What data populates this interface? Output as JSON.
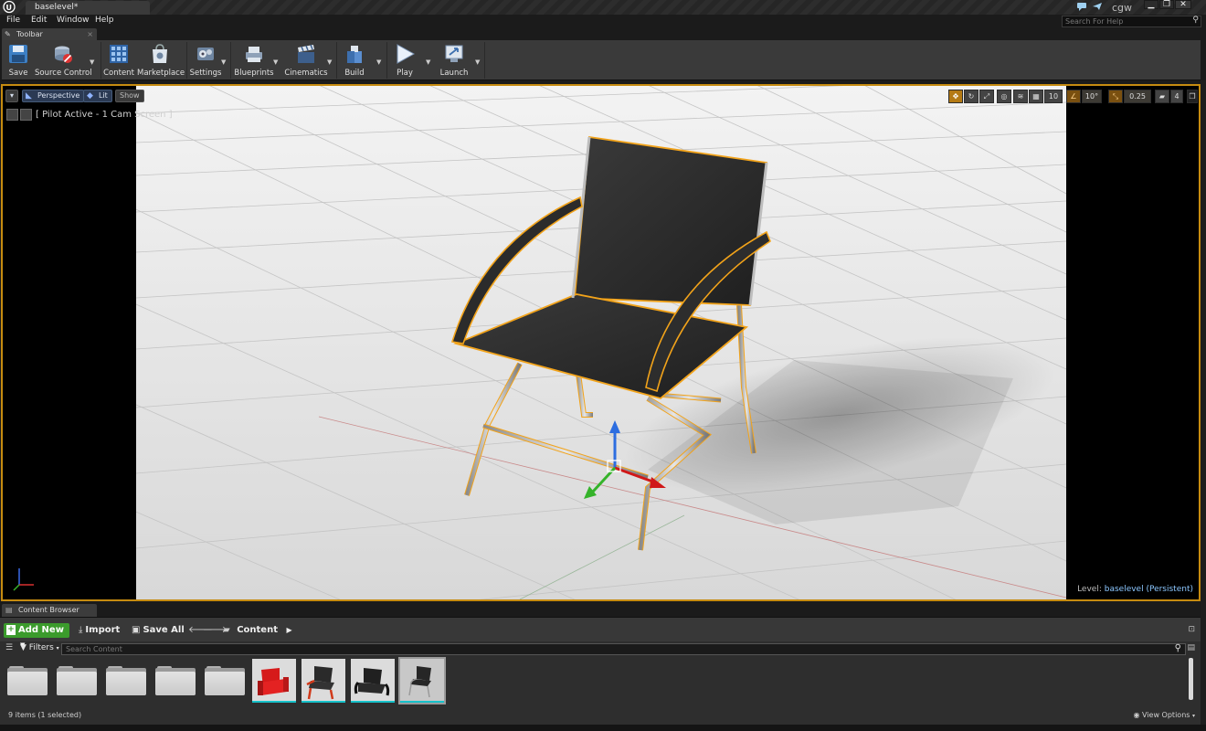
{
  "window": {
    "doc_tab": "baselevel*",
    "user": "cgw",
    "help_search_placeholder": "Search For Help"
  },
  "menu": [
    "File",
    "Edit",
    "Window",
    "Help"
  ],
  "toolbar": {
    "tab_label": "Toolbar",
    "buttons": [
      {
        "label": "Save",
        "icon": "save-icon"
      },
      {
        "label": "Source Control",
        "icon": "source-control-icon"
      },
      {
        "label": "Content",
        "icon": "content-icon"
      },
      {
        "label": "Marketplace",
        "icon": "marketplace-icon"
      },
      {
        "label": "Settings",
        "icon": "settings-icon"
      },
      {
        "label": "Blueprints",
        "icon": "blueprints-icon"
      },
      {
        "label": "Cinematics",
        "icon": "cinematics-icon"
      },
      {
        "label": "Build",
        "icon": "build-icon"
      },
      {
        "label": "Play",
        "icon": "play-icon"
      },
      {
        "label": "Launch",
        "icon": "launch-icon"
      }
    ]
  },
  "viewport": {
    "perspective": "Perspective",
    "lit": "Lit",
    "show": "Show",
    "pilot": "[ Pilot Active - 1 Cam Screen ]",
    "grid_snap": "10",
    "rotate_snap": "10°",
    "scale_snap": "0.25",
    "camera_speed": "4",
    "level_prefix": "Level:",
    "level_name": "baselevel (Persistent)"
  },
  "content_browser": {
    "tab_label": "Content Browser",
    "add_new": "Add New",
    "import": "Import",
    "save_all": "Save All",
    "path": "Content",
    "filters": "Filters",
    "search_placeholder": "Search Content",
    "status": "9 items (1 selected)",
    "view_options": "View Options",
    "folder_count": 5,
    "assets": [
      {
        "icon": "red-chair-thumbnail",
        "selected": false
      },
      {
        "icon": "black-chair-red-frame-thumbnail",
        "selected": false
      },
      {
        "icon": "black-chair-thumbnail",
        "selected": false
      },
      {
        "icon": "chair-mesh-thumbnail",
        "selected": true
      }
    ]
  },
  "colors": {
    "accent_orange": "#c68b10",
    "selection_outline": "#f2a31a",
    "add_new_green": "#3b9b2c",
    "asset_underline": "#17c2ca"
  }
}
